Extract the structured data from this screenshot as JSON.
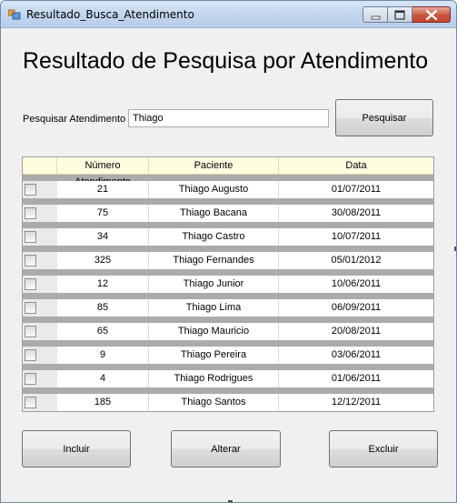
{
  "window": {
    "title": "Resultado_Busca_Atendimento"
  },
  "heading": "Resultado de Pesquisa por Atendimento",
  "search": {
    "label": "Pesquisar Atendimento",
    "value": "Thiago",
    "button_label": "Pesquisar"
  },
  "grid": {
    "columns": [
      "Número Atendimento",
      "Paciente",
      "Data"
    ],
    "rows": [
      {
        "numero": "21",
        "paciente": "Thiago Augusto",
        "data": "01/07/2011"
      },
      {
        "numero": "75",
        "paciente": "Thiago Bacana",
        "data": "30/08/2011"
      },
      {
        "numero": "34",
        "paciente": "Thiago Castro",
        "data": "10/07/2011"
      },
      {
        "numero": "325",
        "paciente": "Thiago Fernandes",
        "data": "05/01/2012"
      },
      {
        "numero": "12",
        "paciente": "Thiago Junior",
        "data": "10/06/2011"
      },
      {
        "numero": "85",
        "paciente": "Thiago Lima",
        "data": "06/09/2011"
      },
      {
        "numero": "65",
        "paciente": "Thiago Mauricio",
        "data": "20/08/2011"
      },
      {
        "numero": "9",
        "paciente": "Thiago Pereira",
        "data": "03/06/2011"
      },
      {
        "numero": "4",
        "paciente": "Thiago Rodrigues",
        "data": "01/06/2011"
      },
      {
        "numero": "185",
        "paciente": "Thiago Santos",
        "data": "12/12/2011"
      }
    ]
  },
  "actions": {
    "incluir": "Incluir",
    "alterar": "Alterar",
    "excluir": "Excluir"
  },
  "icons": {
    "app": "app-window-icon",
    "minimize": "minimize-icon",
    "maximize": "maximize-icon",
    "close": "close-icon"
  },
  "colors": {
    "header_bg": "#fffde0",
    "row_separator": "#ababab",
    "close_button": "#c8553f"
  }
}
